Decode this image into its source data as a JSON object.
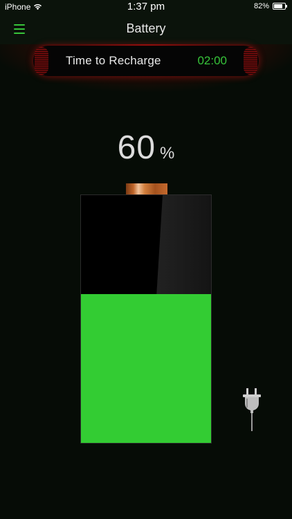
{
  "status_bar": {
    "carrier": "iPhone",
    "time": "1:37 pm",
    "battery_percent": "82%",
    "battery_fill_fraction": 0.82,
    "icons": [
      "wifi-icon",
      "status-battery-icon"
    ]
  },
  "nav": {
    "title": "Battery",
    "menu_icon": "hamburger-menu-icon"
  },
  "recharge": {
    "label": "Time to Recharge",
    "value": "02:00"
  },
  "battery": {
    "percent_value": "60",
    "percent_sign": "%",
    "level_fraction": 0.6,
    "plug_icon": "power-plug-icon"
  },
  "colors": {
    "accent_green": "#37c43a",
    "battery_fill": "#33cc33",
    "glow_red": "#af0c0c",
    "background": "#060c06"
  }
}
